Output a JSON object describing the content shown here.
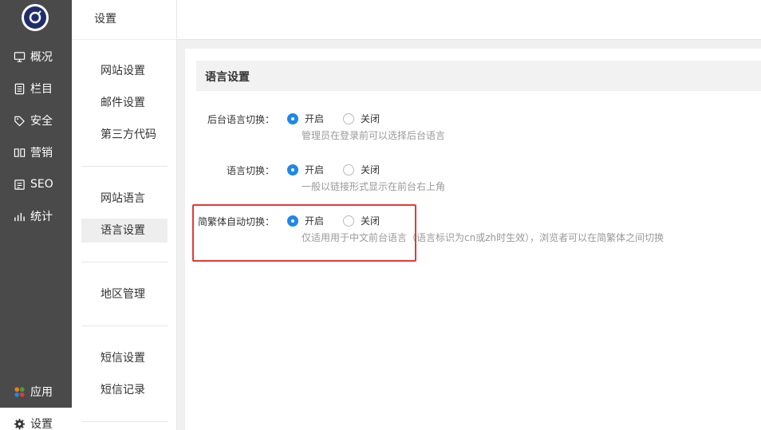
{
  "nav": {
    "items": [
      {
        "label": "概况",
        "icon": "monitor-icon"
      },
      {
        "label": "栏目",
        "icon": "list-icon"
      },
      {
        "label": "安全",
        "icon": "tag-icon"
      },
      {
        "label": "营销",
        "icon": "book-icon"
      },
      {
        "label": "SEO",
        "icon": "seo-icon"
      },
      {
        "label": "统计",
        "icon": "chart-icon"
      }
    ],
    "apps_label": "应用",
    "settings_label": "设置"
  },
  "subnav": {
    "title": "设置",
    "groups": [
      [
        "网站设置",
        "邮件设置",
        "第三方代码"
      ],
      [
        "网站语言",
        "语言设置"
      ],
      [
        "地区管理"
      ],
      [
        "短信设置",
        "短信记录"
      ]
    ],
    "active": "语言设置"
  },
  "main": {
    "section_title": "语言设置",
    "rows": [
      {
        "label": "后台语言切换：",
        "options": [
          "开启",
          "关闭"
        ],
        "selected": "开启",
        "hint": "管理员在登录前可以选择后台语言"
      },
      {
        "label": "语言切换：",
        "options": [
          "开启",
          "关闭"
        ],
        "selected": "开启",
        "hint": "一般以链接形式显示在前台右上角"
      },
      {
        "label": "简繁体自动切换：",
        "options": [
          "开启",
          "关闭"
        ],
        "selected": "开启",
        "hint": "仅适用用于中文前台语言（语言标识为cn或zh时生效），浏览者可以在简繁体之间切换"
      }
    ]
  },
  "colors": {
    "accent": "#1e88e5",
    "nav_bg": "#4a4a4a",
    "highlight": "#e53935"
  }
}
